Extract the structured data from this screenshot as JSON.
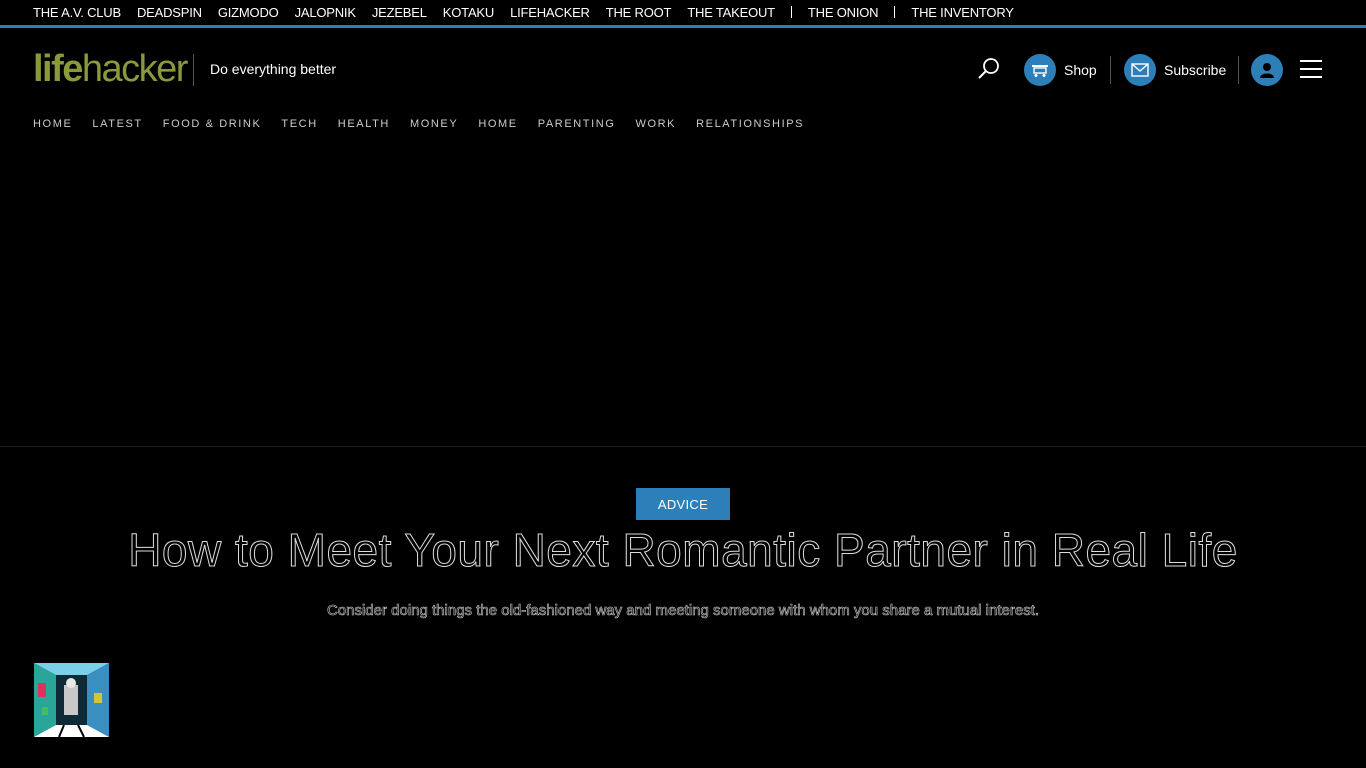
{
  "network": {
    "links": [
      "THE A.V. CLUB",
      "DEADSPIN",
      "GIZMODO",
      "JALOPNIK",
      "JEZEBEL",
      "KOTAKU",
      "LIFEHACKER",
      "THE ROOT",
      "THE TAKEOUT"
    ],
    "links_after_sep1": [
      "THE ONION"
    ],
    "links_after_sep2": [
      "THE INVENTORY"
    ],
    "accent_color": "#2c7fb8"
  },
  "header": {
    "logo_life": "life",
    "logo_hacker": "hacker",
    "tagline": "Do everything better",
    "shop_label": "Shop",
    "subscribe_label": "Subscribe",
    "icons": [
      "search-icon",
      "cart-icon",
      "mail-icon",
      "user-icon",
      "hamburger-icon"
    ]
  },
  "nav": {
    "items": [
      "HOME",
      "LATEST",
      "FOOD & DRINK",
      "TECH",
      "HEALTH",
      "MONEY",
      "HOME",
      "PARENTING",
      "WORK",
      "RELATIONSHIPS"
    ]
  },
  "article": {
    "category": "ADVICE",
    "headline": "How to Meet Your Next Romantic Partner in Real Life",
    "subhead": "Consider doing things the old-fashioned way and meeting someone with whom you share a mutual interest."
  }
}
